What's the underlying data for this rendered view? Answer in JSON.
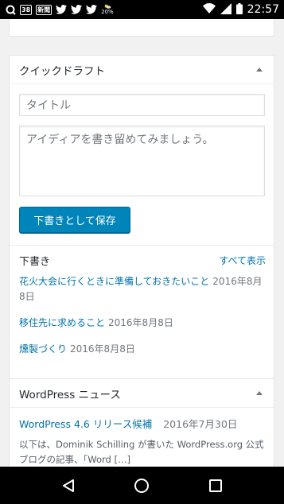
{
  "status_bar": {
    "icons": [
      "q-icon",
      "calendar-icon",
      "news-icon",
      "twitter-icon",
      "twitter-icon",
      "twitter-icon",
      "weather-icon"
    ],
    "calendar_text": "38",
    "news_text": "新聞",
    "weather_percent": "20%",
    "time": "22:57"
  },
  "quick_draft": {
    "title": "クイックドラフト",
    "title_placeholder": "タイトル",
    "content_placeholder": "アイディアを書き留めてみましょう。",
    "save_label": "下書きとして保存",
    "drafts_heading": "下書き",
    "view_all": "すべて表示",
    "drafts": [
      {
        "title": "花火大会に行くときに準備しておきたいこと",
        "date": "2016年8月8日"
      },
      {
        "title": "移住先に求めること",
        "date": "2016年8月8日"
      },
      {
        "title": "燻製づくり",
        "date": "2016年8月8日"
      }
    ]
  },
  "news": {
    "title": "WordPress ニュース",
    "items": [
      {
        "title": "WordPress 4.6 リリース候補",
        "date": "2016年7月30日",
        "excerpt": "以下は、Dominik Schilling が書いた WordPress.org 公式ブログの記事、「Word […]"
      }
    ]
  },
  "colors": {
    "link": "#0073aa",
    "primary_button": "#0085ba",
    "background": "#f1f1f1"
  }
}
